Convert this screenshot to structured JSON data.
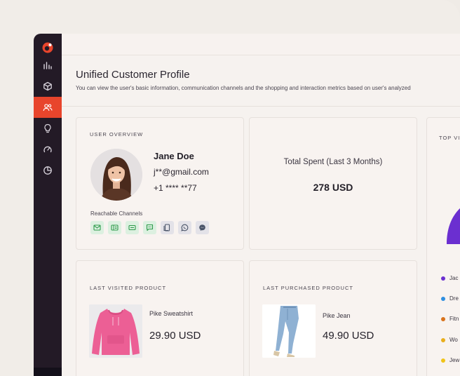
{
  "header": {
    "title": "Unified Customer Profile",
    "subtitle": "You can view the user's basic information, communication channels and the shopping and interaction metrics based on user's analyzed"
  },
  "sidebar": {
    "items": [
      {
        "icon": "bar-chart-icon",
        "active": false
      },
      {
        "icon": "cube-icon",
        "active": false
      },
      {
        "icon": "users-icon",
        "active": true
      },
      {
        "icon": "lightbulb-icon",
        "active": false
      },
      {
        "icon": "gauge-icon",
        "active": false
      },
      {
        "icon": "pie-chart-icon",
        "active": false
      }
    ]
  },
  "user_overview": {
    "title": "USER OVERVIEW",
    "name": "Jane Doe",
    "email": "j**@gmail.com",
    "phone": "+1 **** **77",
    "channels_label": "Reachable Channels",
    "channels": [
      {
        "icon": "email-icon",
        "tone": "green"
      },
      {
        "icon": "id-card-icon",
        "tone": "green"
      },
      {
        "icon": "message-box-icon",
        "tone": "green"
      },
      {
        "icon": "sms-icon",
        "tone": "green"
      },
      {
        "icon": "push-notification-icon",
        "tone": "gray"
      },
      {
        "icon": "whatsapp-icon",
        "tone": "gray"
      },
      {
        "icon": "messenger-icon",
        "tone": "gray"
      }
    ]
  },
  "total_spent": {
    "label": "Total Spent (Last 3 Months)",
    "value": "278 USD"
  },
  "top_card": {
    "title": "TOP VI",
    "legend": [
      {
        "label": "Jac",
        "color": "#6b2fd0"
      },
      {
        "label": "Dre",
        "color": "#2f8fe0"
      },
      {
        "label": "Fitn",
        "color": "#d9731c"
      },
      {
        "label": "Wo",
        "color": "#e8ae1c"
      },
      {
        "label": "Jew",
        "color": "#f0c419"
      }
    ]
  },
  "last_visited": {
    "title": "LAST VISITED PRODUCT",
    "name": "Pike Sweatshirt",
    "price": "29.90 USD"
  },
  "last_purchased": {
    "title": "LAST PURCHASED PRODUCT",
    "name": "Pike Jean",
    "price": "49.90 USD"
  },
  "colors": {
    "accent": "#e8452c",
    "sidebar": "#231a26",
    "chart_purple": "#6b2fd0"
  }
}
